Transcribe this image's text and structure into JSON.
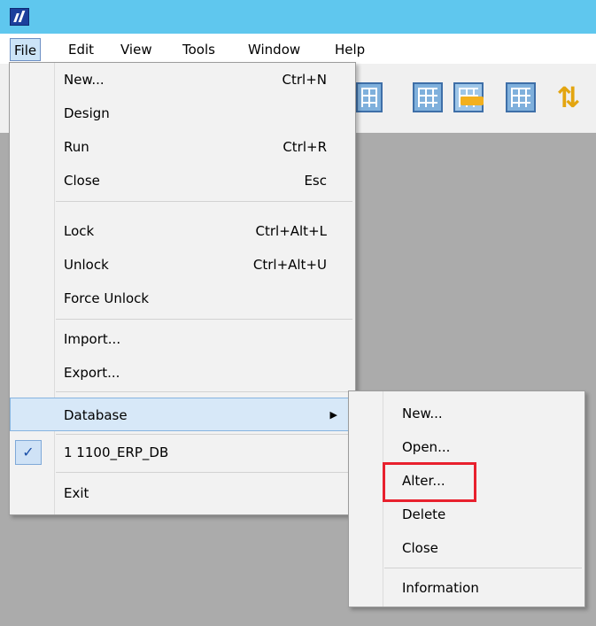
{
  "menubar": [
    "File",
    "Edit",
    "View",
    "Tools",
    "Window",
    "Help"
  ],
  "toolbar_icons": [
    "table-icon",
    "table-icon",
    "table-import-icon",
    "table-icon",
    "refresh-icon"
  ],
  "file_menu": {
    "new": {
      "label": "New...",
      "shortcut": "Ctrl+N"
    },
    "design": {
      "label": "Design"
    },
    "run": {
      "label": "Run",
      "shortcut": "Ctrl+R"
    },
    "close": {
      "label": "Close",
      "shortcut": "Esc"
    },
    "lock": {
      "label": "Lock",
      "shortcut": "Ctrl+Alt+L"
    },
    "unlock": {
      "label": "Unlock",
      "shortcut": "Ctrl+Alt+U"
    },
    "force_unlock": {
      "label": "Force Unlock"
    },
    "import": {
      "label": "Import..."
    },
    "export": {
      "label": "Export..."
    },
    "database": {
      "label": "Database",
      "arrow": "▶"
    },
    "recent": {
      "check": "✓",
      "label": "1 1100_ERP_DB"
    },
    "exit": {
      "label": "Exit"
    }
  },
  "database_submenu": {
    "new": "New...",
    "open": "Open...",
    "alter": "Alter...",
    "delete": "Delete",
    "close": "Close",
    "information": "Information"
  },
  "colors": {
    "titlebar": "#5fc7ee",
    "workspace": "#ababab",
    "highlight": "#d7e8f8",
    "annotation": "#e8212e"
  }
}
